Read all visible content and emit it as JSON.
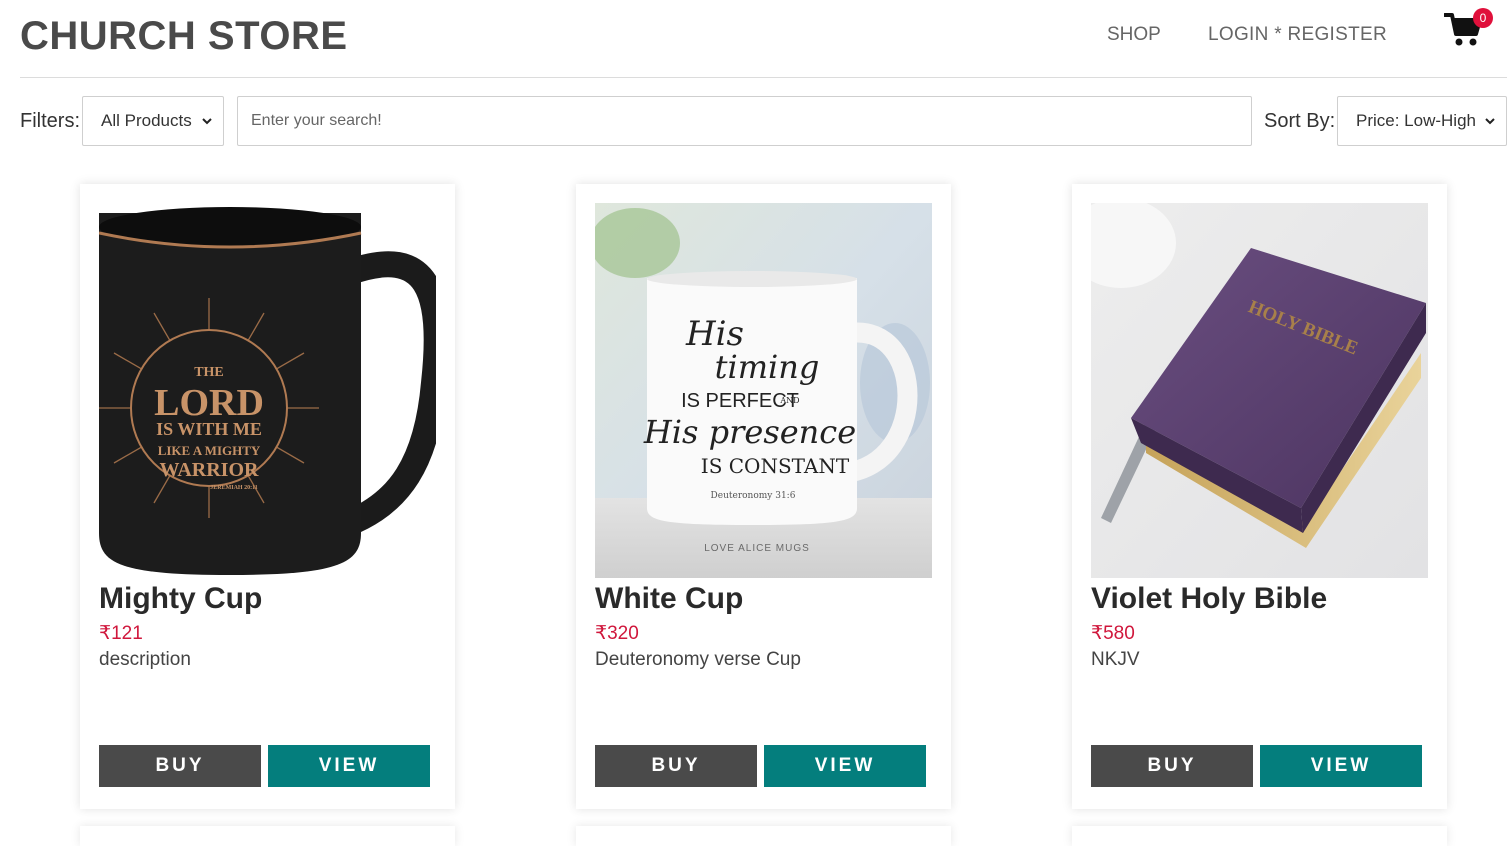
{
  "header": {
    "brand": "CHURCH STORE",
    "nav_shop": "SHOP",
    "nav_login_register": "LOGIN * REGISTER",
    "cart_count": "0",
    "cart_icon": "shopping-cart-icon"
  },
  "toolbar": {
    "filters_label": "Filters:",
    "filter_selected": "All Products",
    "search_placeholder": "Enter your search!",
    "sort_label": "Sort By:",
    "sort_selected": "Price: Low-High"
  },
  "products": [
    {
      "name": "Mighty Cup",
      "price": "₹121",
      "description": "description",
      "buy_label": "BUY",
      "view_label": "VIEW",
      "image_text": [
        "THE",
        "LORD",
        "IS WITH ME",
        "LIKE A MIGHTY",
        "WARRIOR",
        "JEREMIAH 20:11"
      ]
    },
    {
      "name": "White Cup",
      "price": "₹320",
      "description": "Deuteronomy verse Cup",
      "buy_label": "BUY",
      "view_label": "VIEW",
      "image_text": [
        "His",
        "timing",
        "IS PERFECT",
        "AND",
        "His presence",
        "IS CONSTANT",
        "Deuteronomy 31:6",
        "LOVE ALICE MUGS"
      ]
    },
    {
      "name": "Violet Holy Bible",
      "price": "₹580",
      "description": "NKJV",
      "buy_label": "BUY",
      "view_label": "VIEW",
      "image_text": [
        "HOLY BIBLE"
      ]
    }
  ],
  "colors": {
    "brand_text": "#4a4a4a",
    "price": "#d0173c",
    "buy_button": "#4a4a4a",
    "view_button": "#047e7d",
    "badge": "#e0103b"
  }
}
